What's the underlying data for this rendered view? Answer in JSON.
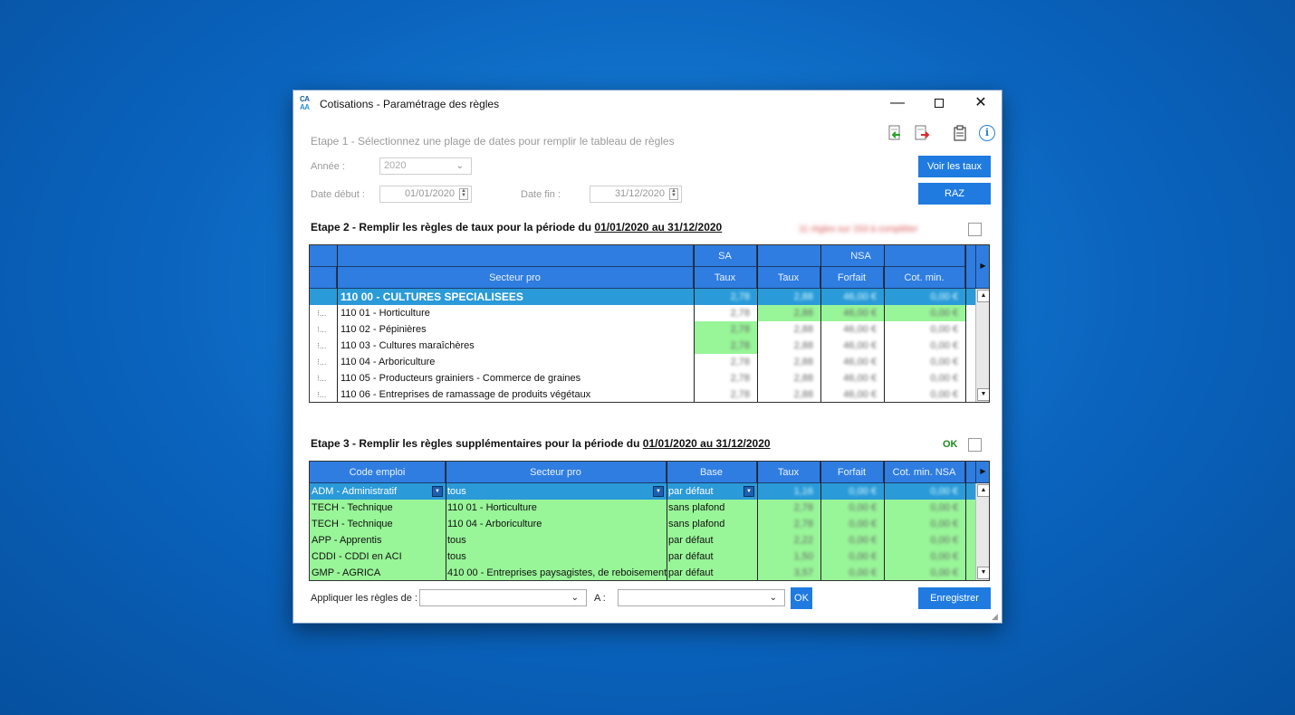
{
  "window": {
    "logo_line1": "CA",
    "logo_line2": "AA",
    "title": "Cotisations - Paramétrage des règles",
    "min_glyph": "—",
    "close_glyph": "✕"
  },
  "toolbar": {
    "icons": [
      "import-icon",
      "export-icon",
      "clipboard-icon",
      "info-icon"
    ],
    "info_glyph": "i"
  },
  "step1": {
    "title": "Etape 1 - Sélectionnez une plage de dates pour remplir le tableau de règles",
    "year_label": "Année :",
    "year_value": "2020",
    "date_start_label": "Date début :",
    "date_start_value": "01/01/2020",
    "date_end_label": "Date fin :",
    "date_end_value": "31/12/2020",
    "voir_taux_label": "Voir les taux",
    "raz_label": "RAZ"
  },
  "step2": {
    "title_prefix": "Etape 2 - Remplir les règles de taux pour la période du ",
    "period": "01/01/2020 au 31/12/2020",
    "status_text": "11 règles sur 153 à compléter",
    "headers": {
      "sa": "SA",
      "nsa": "NSA",
      "secteur": "Secteur pro",
      "taux_sa": "Taux",
      "taux_nsa": "Taux",
      "forfait": "Forfait",
      "cot_min": "Cot. min."
    },
    "rows": [
      {
        "prefix": "",
        "secteur": "110 00 - CULTURES SPECIALISEES",
        "sa": "2,78",
        "taux": "2,88",
        "forfait": "46,00 €",
        "cot": "0,00 €",
        "selected": true,
        "green": []
      },
      {
        "prefix": "⁝...",
        "secteur": "110 01 - Horticulture",
        "sa": "2,78",
        "taux": "2,88",
        "forfait": "46,00 €",
        "cot": "0,00 €",
        "selected": false,
        "green": [
          "taux",
          "forfait",
          "cot"
        ]
      },
      {
        "prefix": "⁝...",
        "secteur": "110 02 - Pépinières",
        "sa": "2,78",
        "taux": "2,88",
        "forfait": "46,00 €",
        "cot": "0,00 €",
        "selected": false,
        "green": [
          "sa"
        ]
      },
      {
        "prefix": "⁝...",
        "secteur": "110 03 - Cultures maraîchères",
        "sa": "2,78",
        "taux": "2,88",
        "forfait": "46,00 €",
        "cot": "0,00 €",
        "selected": false,
        "green": [
          "sa"
        ]
      },
      {
        "prefix": "⁝...",
        "secteur": "110 04 - Arboriculture",
        "sa": "2,78",
        "taux": "2,88",
        "forfait": "46,00 €",
        "cot": "0,00 €",
        "selected": false,
        "green": []
      },
      {
        "prefix": "⁝...",
        "secteur": "110 05 - Producteurs grainiers - Commerce de graines",
        "sa": "2,78",
        "taux": "2,88",
        "forfait": "46,00 €",
        "cot": "0,00 €",
        "selected": false,
        "green": []
      },
      {
        "prefix": "⁝...",
        "secteur": "110 06 - Entreprises de ramassage de produits végétaux",
        "sa": "2,78",
        "taux": "2,88",
        "forfait": "46,00 €",
        "cot": "0,00 €",
        "selected": false,
        "green": []
      }
    ]
  },
  "step3": {
    "title_prefix": "Etape 3 - Remplir les règles supplémentaires pour la période du ",
    "period": "01/01/2020 au 31/12/2020",
    "ok_label": "OK",
    "headers": {
      "code": "Code emploi",
      "secteur": "Secteur pro",
      "base": "Base",
      "taux": "Taux",
      "forfait": "Forfait",
      "cot_min": "Cot. min. NSA"
    },
    "rows": [
      {
        "code": "ADM - Administratif",
        "secteur": "tous",
        "base": "par défaut",
        "taux": "1,16",
        "forfait": "0,00 €",
        "cot": "0,00 €",
        "selected": true
      },
      {
        "code": "TECH - Technique",
        "secteur": "110 01 - Horticulture",
        "base": "sans plafond",
        "taux": "2,78",
        "forfait": "0,00 €",
        "cot": "0,00 €",
        "selected": false
      },
      {
        "code": "TECH - Technique",
        "secteur": "110 04 - Arboriculture",
        "base": "sans plafond",
        "taux": "2,78",
        "forfait": "0,00 €",
        "cot": "0,00 €",
        "selected": false
      },
      {
        "code": "APP - Apprentis",
        "secteur": "tous",
        "base": "par défaut",
        "taux": "2,22",
        "forfait": "0,00 €",
        "cot": "0,00 €",
        "selected": false
      },
      {
        "code": "CDDI - CDDI en ACI",
        "secteur": "tous",
        "base": "par défaut",
        "taux": "1,50",
        "forfait": "0,00 €",
        "cot": "0,00 €",
        "selected": false
      },
      {
        "code": "GMP - AGRICA",
        "secteur": "410 00 - Entreprises paysagistes, de reboisement",
        "base": "par défaut",
        "taux": "3,57",
        "forfait": "0,00 €",
        "cot": "0,00 €",
        "selected": false
      }
    ]
  },
  "footer": {
    "apply_label": "Appliquer les règles de :",
    "apply_from_value": "",
    "a_label": "A :",
    "apply_to_value": "",
    "ok_label": "OK",
    "save_label": "Enregistrer"
  },
  "colors": {
    "header_blue": "#2f7de0",
    "selected_row": "#2a9ad8",
    "green": "#98f598",
    "button_blue": "#1f7be0",
    "desktop": "#0a63bd"
  }
}
